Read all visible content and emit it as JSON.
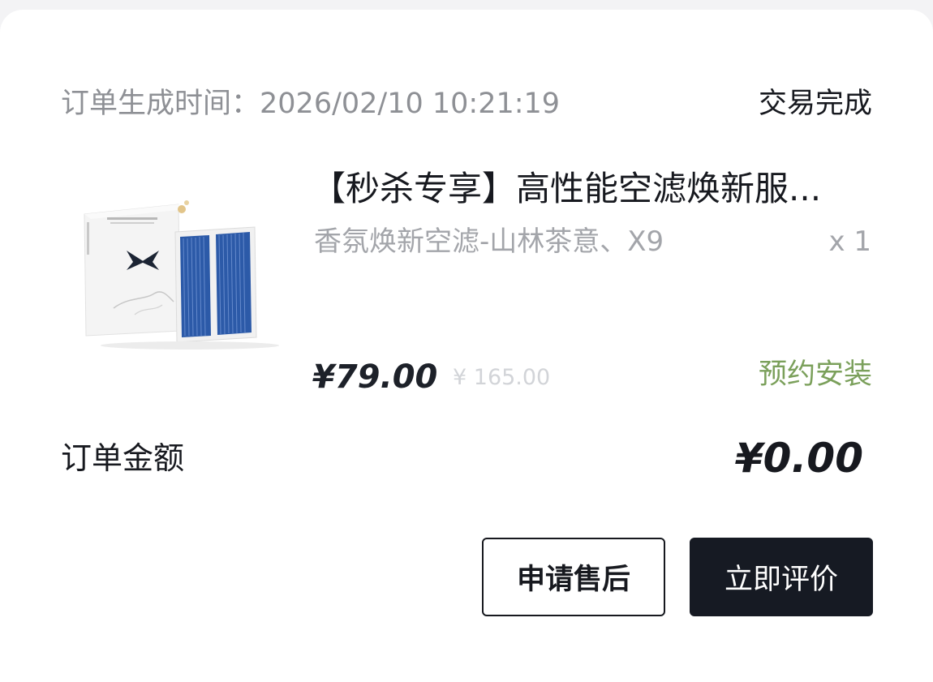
{
  "order": {
    "time_label": "订单生成时间：",
    "time_value": "2026/02/10 10:21:19",
    "status": "交易完成"
  },
  "product": {
    "title": "【秒杀专享】高性能空滤焕新服...",
    "spec": "香氛焕新空滤-山林茶意、X9",
    "quantity": "x 1",
    "price_current": "¥79.00",
    "price_original": "¥ 165.00",
    "install_action": "预约安装",
    "image": {
      "description_icon": "product-box-icon",
      "box_color": "#f7f7f7",
      "filter_color": "#2c5aa8",
      "logo_color": "#1b2433"
    }
  },
  "summary": {
    "amount_label": "订单金额",
    "amount_value": "¥0.00"
  },
  "actions": {
    "after_sale_label": "申请售后",
    "review_label": "立即评价"
  },
  "colors": {
    "primary_text": "#17191f",
    "secondary_text": "#8e9095",
    "muted_text": "#a3a5aa",
    "install_green": "#7ba05b",
    "button_dark": "#161a23"
  }
}
